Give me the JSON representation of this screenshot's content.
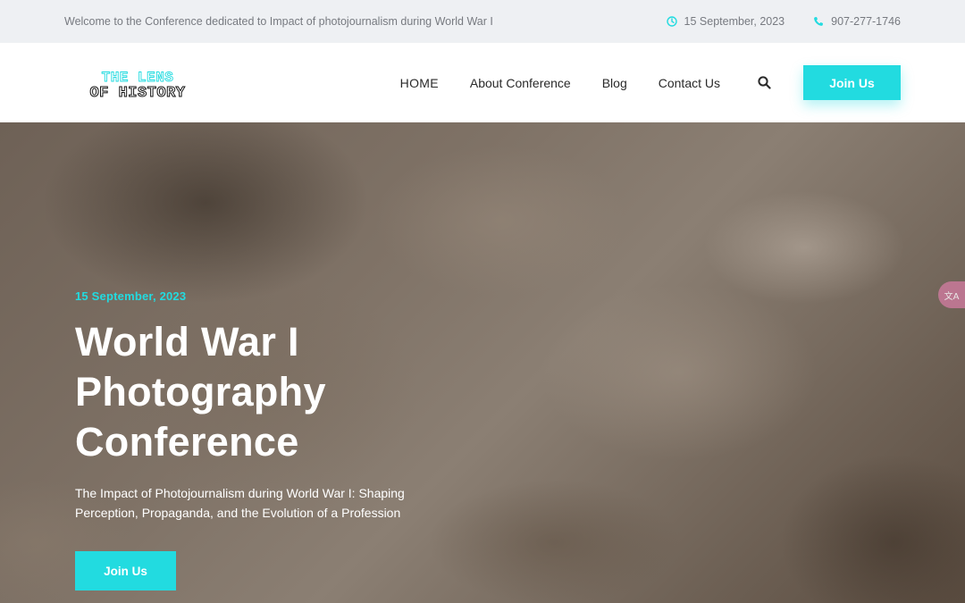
{
  "topbar": {
    "welcome": "Welcome to the Conference dedicated to Impact of photojournalism during World War I",
    "date": "15 September, 2023",
    "phone": "907-277-1746",
    "icons": {
      "date": "clock-icon",
      "phone": "phone-icon"
    }
  },
  "header": {
    "logo": {
      "line1": "THE LENS",
      "line2": "OF HISTORY"
    },
    "nav": [
      {
        "label": "HOME"
      },
      {
        "label": "About Conference"
      },
      {
        "label": "Blog"
      },
      {
        "label": "Contact Us"
      }
    ],
    "search_icon": "search-icon",
    "join_label": "Join Us"
  },
  "hero": {
    "date": "15 September, 2023",
    "title": "World War I Photography Conference",
    "subtitle": "The Impact of Photojournalism during World War I: Shaping Perception, Propaganda, and the Evolution of a Profession",
    "join_label": "Join Us",
    "translate_icon": "translate-icon"
  },
  "colors": {
    "accent": "#22dbe0",
    "topbar_bg": "#eef0f3",
    "text_dark": "#2a2a2a",
    "text_muted": "#777a80"
  }
}
